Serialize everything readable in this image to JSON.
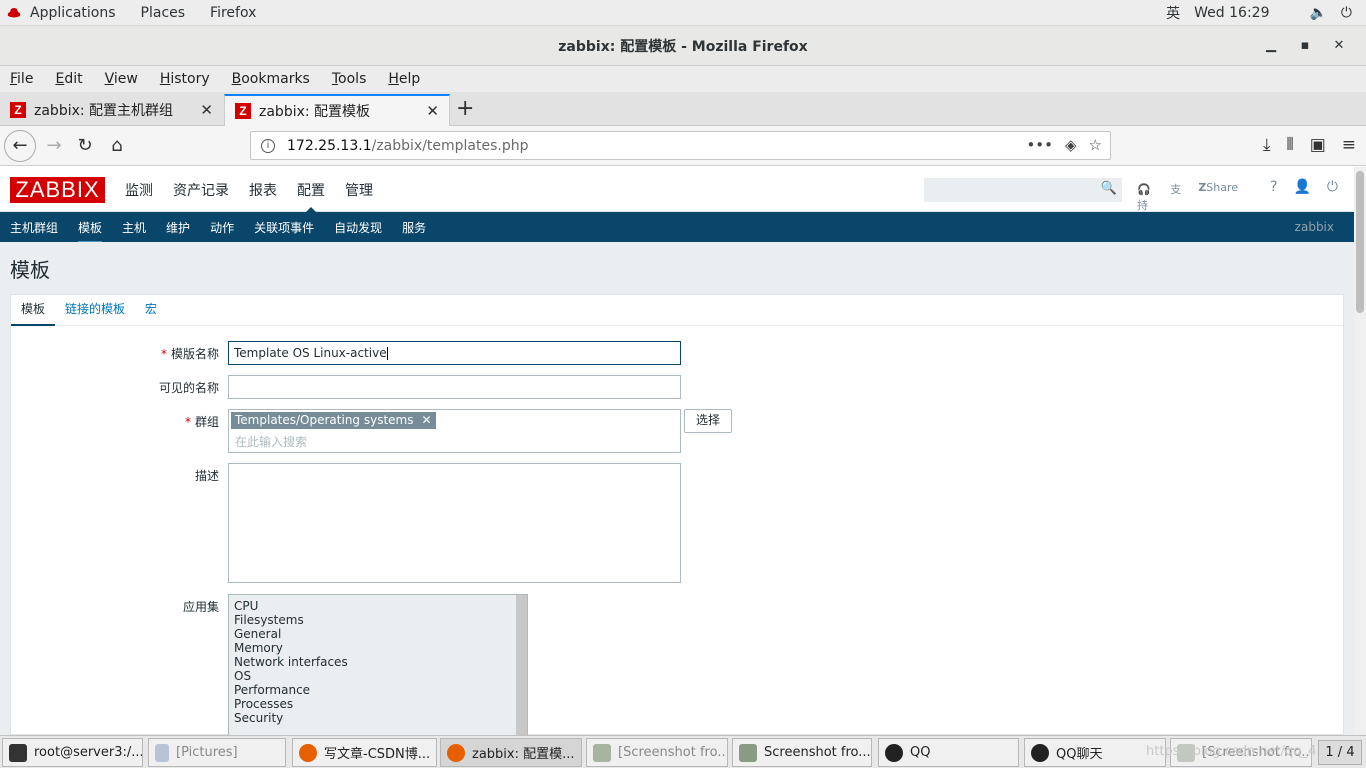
{
  "gnome": {
    "applications": "Applications",
    "places": "Places",
    "firefox": "Firefox",
    "ime": "英",
    "clock": "Wed 16:29"
  },
  "window": {
    "title": "zabbix: 配置模板 - Mozilla Firefox"
  },
  "menubar": [
    "File",
    "Edit",
    "View",
    "History",
    "Bookmarks",
    "Tools",
    "Help"
  ],
  "tabs": [
    {
      "title": "zabbix: 配置主机群组"
    },
    {
      "title": "zabbix: 配置模板"
    }
  ],
  "url": {
    "host": "172.25.13.1",
    "path": "/zabbix/templates.php"
  },
  "zabbix": {
    "logo": "ZABBIX",
    "main_menu": [
      "监测",
      "资产记录",
      "报表",
      "配置",
      "管理"
    ],
    "support": "支持",
    "share": "Share",
    "help": "?",
    "sub_menu": [
      "主机群组",
      "模板",
      "主机",
      "维护",
      "动作",
      "关联项事件",
      "自动发现",
      "服务"
    ],
    "user": "zabbix",
    "page_title": "模板",
    "form_tabs": [
      "模板",
      "链接的模板",
      "宏"
    ],
    "form": {
      "template_name_label": "模版名称",
      "template_name_value": "Template OS Linux-active",
      "visible_name_label": "可见的名称",
      "visible_name_value": "",
      "groups_label": "群组",
      "group_tag": "Templates/Operating systems",
      "groups_placeholder": "在此输入搜索",
      "select_button": "选择",
      "description_label": "描述",
      "description_value": "",
      "applications_label": "应用集",
      "applications": [
        "CPU",
        "Filesystems",
        "General",
        "Memory",
        "Network interfaces",
        "OS",
        "Performance",
        "Processes",
        "Security"
      ]
    }
  },
  "taskbar": {
    "items": [
      "root@server3:/...",
      "[Pictures]",
      "写文章-CSDN博...",
      "zabbix: 配置模...",
      "[Screenshot fro...",
      "Screenshot fro...",
      "QQ",
      "QQ聊天",
      "[Screenshot fro..."
    ],
    "watermark": "https://blog.csdn.net/qq_4...",
    "pager": "1 / 4"
  }
}
